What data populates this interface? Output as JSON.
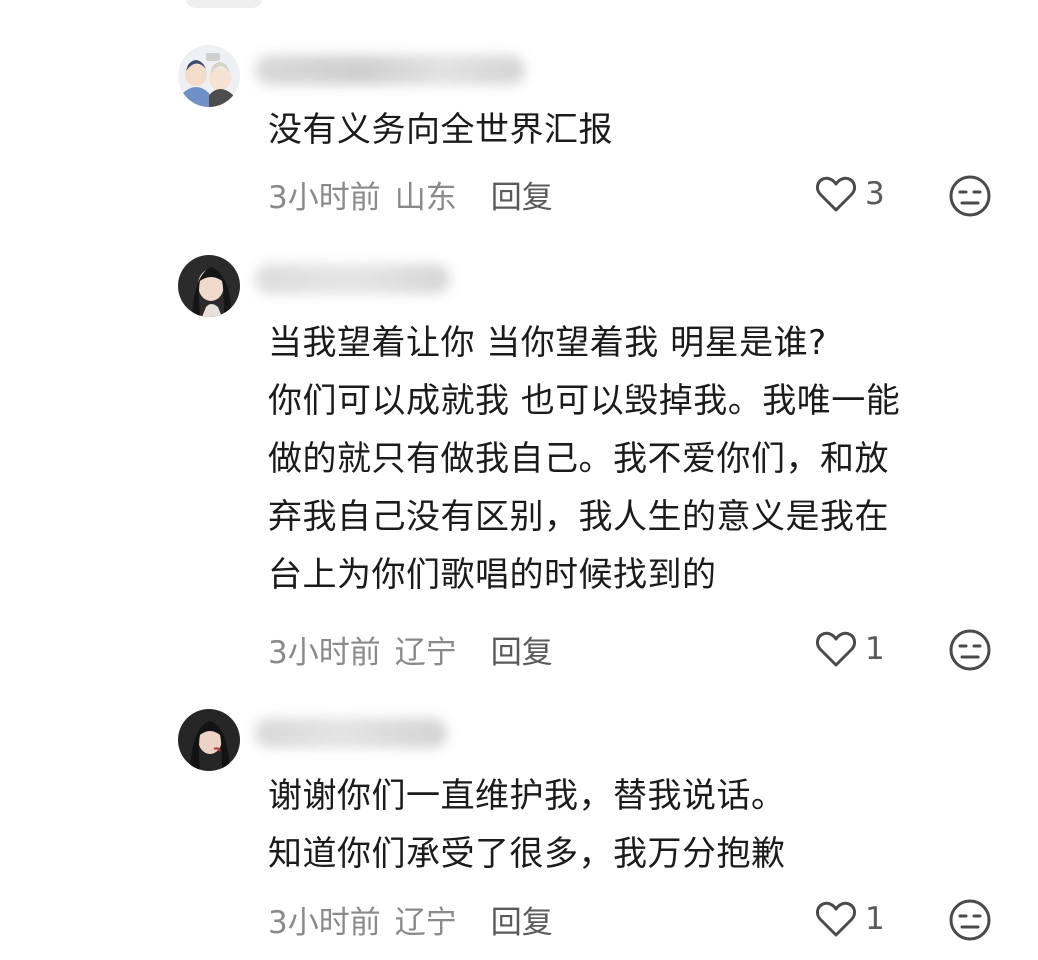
{
  "comments": [
    {
      "lines": [
        "没有义务向全世界汇报"
      ],
      "time": "3小时前",
      "location": "山东",
      "reply_label": "回复",
      "like_count": "3"
    },
    {
      "lines": [
        "当我望着让你 当你望着我 明星是谁?",
        "你们可以成就我 也可以毁掉我。我唯一能",
        "做的就只有做我自己。我不爱你们，和放",
        "弃我自己没有区别，我人生的意义是我在",
        "台上为你们歌唱的时候找到的"
      ],
      "time": "3小时前",
      "location": "辽宁",
      "reply_label": "回复",
      "like_count": "1"
    },
    {
      "lines": [
        "谢谢你们一直维护我，替我说话。",
        "知道你们承受了很多，我万分抱歉"
      ],
      "time": "3小时前",
      "location": "辽宁",
      "reply_label": "回复",
      "like_count": "1"
    }
  ],
  "icons": {
    "like": "heart-outline-icon",
    "dislike": "meh-face-icon"
  },
  "colors": {
    "text": "#1b1b1b",
    "meta": "#8a8a8a",
    "action": "#5a5a5a",
    "icon": "#4a4a4a"
  }
}
